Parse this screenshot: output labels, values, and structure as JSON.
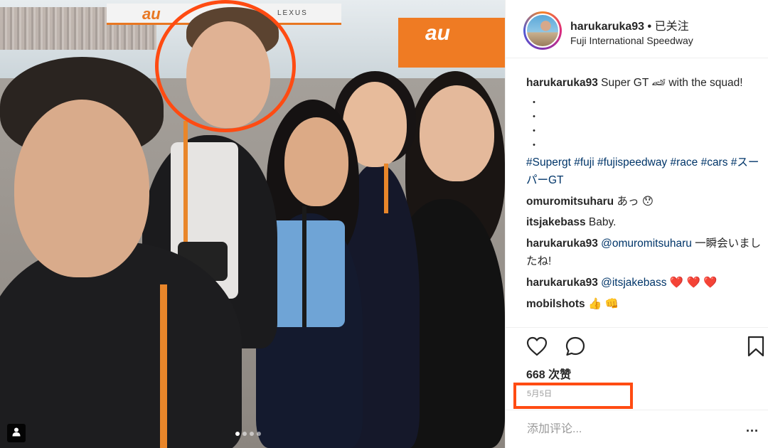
{
  "post": {
    "username": "harukaruka93",
    "separator": "•",
    "follow_status": "已关注",
    "location": "Fuji International Speedway",
    "banner_brand": "au",
    "banner_lexus": "LEXUS",
    "pit_brand": "au",
    "carousel": {
      "count": 4,
      "active_index": 0
    },
    "caption": {
      "username": "harukaruka93",
      "text": "Super GT 🏎 with the squad!",
      "bullets": [
        "・",
        "・",
        "・",
        "・"
      ],
      "hashtags": "#Supergt #fuji #fujispeedway #race #cars #スーパーGT"
    },
    "comments": [
      {
        "user": "omuromitsuharu",
        "text": "あっ 😯"
      },
      {
        "user": "itsjakebass",
        "text": "Baby."
      },
      {
        "user": "harukaruka93",
        "mention": "@omuromitsuharu",
        "text": "一瞬会いましたね!"
      },
      {
        "user": "harukaruka93",
        "mention": "@itsjakebass",
        "text": "❤️ ❤️ ❤️"
      },
      {
        "user": "mobilshots",
        "text": "👍 👊"
      }
    ],
    "likes_label": "668 次赞",
    "date": "5月5日",
    "comment_placeholder": "添加评论...",
    "more_label": "..."
  },
  "icons": {
    "like": "heart-icon",
    "comment": "comment-bubble-icon",
    "save": "bookmark-icon",
    "tag": "user-tag-icon",
    "more": "more-options-icon"
  },
  "colors": {
    "highlight": "#ff4b12",
    "link": "#003569",
    "muted": "#999999",
    "text": "#262626"
  }
}
